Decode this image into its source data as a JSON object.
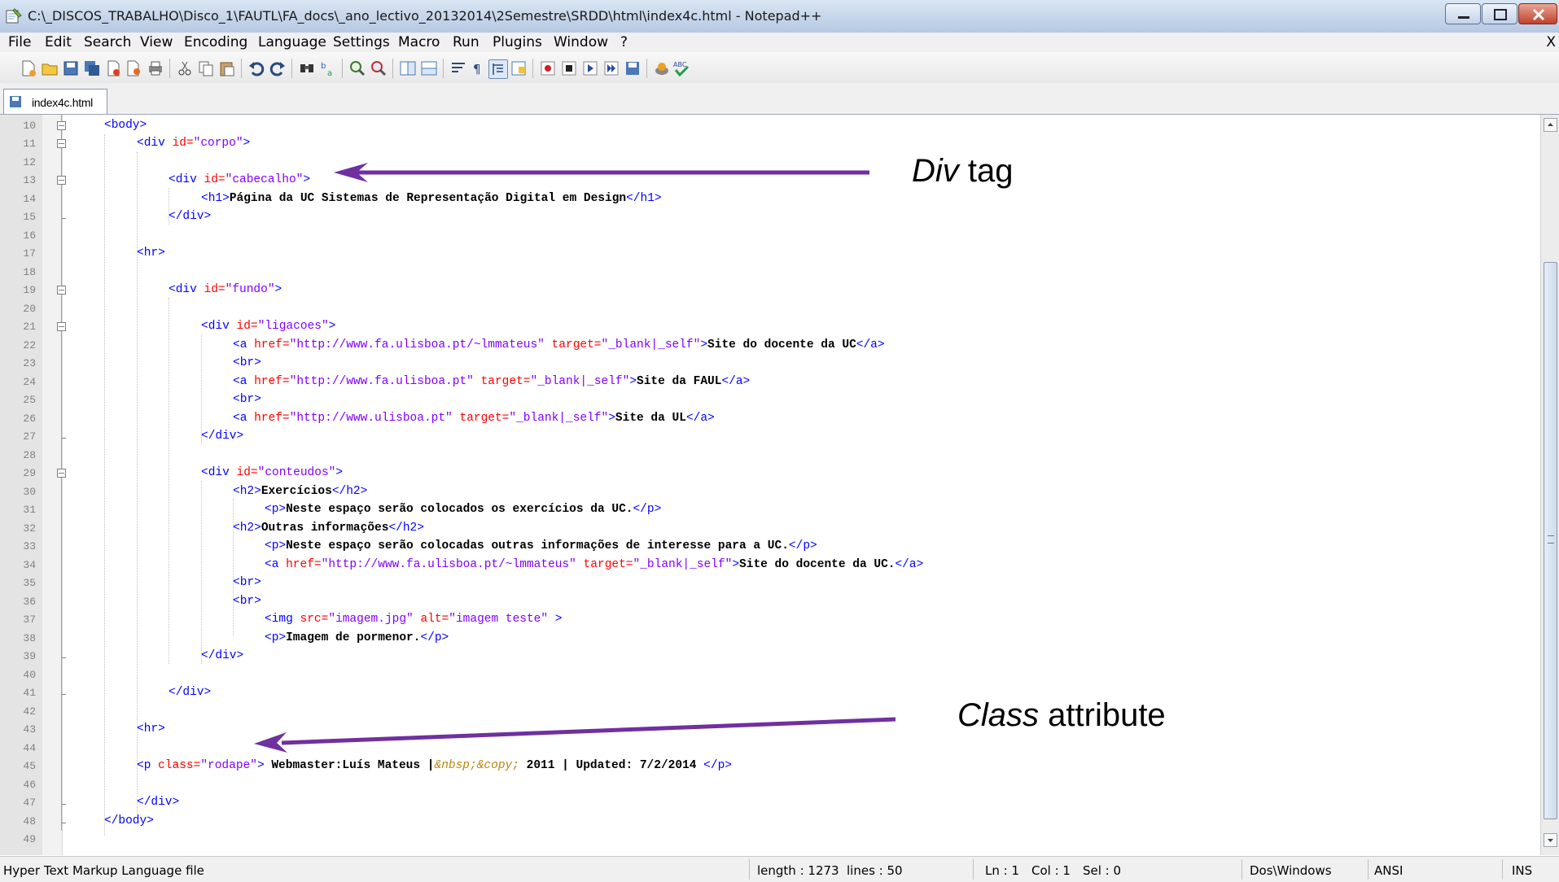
{
  "window": {
    "title": "C:\\_DISCOS_TRABALHO\\Disco_1\\FAUTL\\FA_docs\\_ano_lectivo_20132014\\2Semestre\\SRDD\\html\\index4c.html - Notepad++"
  },
  "menu": {
    "items": [
      "File",
      "Edit",
      "Search",
      "View",
      "Encoding",
      "Language",
      "Settings",
      "Macro",
      "Run",
      "Plugins",
      "Window",
      "?"
    ],
    "close_label": "X"
  },
  "tab": {
    "label": "index4c.html"
  },
  "editor": {
    "line_numbers": [
      "10",
      "11",
      "12",
      "13",
      "14",
      "15",
      "16",
      "17",
      "18",
      "19",
      "20",
      "21",
      "22",
      "23",
      "24",
      "25",
      "26",
      "27",
      "28",
      "29",
      "30",
      "31",
      "32",
      "33",
      "34",
      "35",
      "36",
      "37",
      "38",
      "39",
      "40",
      "41",
      "42",
      "43",
      "44",
      "45",
      "46",
      "47",
      "48",
      "49"
    ],
    "lines": {
      "l10_tag": "<body>",
      "l11_open": "<div ",
      "l11_attr": "id=",
      "l11_val": "\"corpo\"",
      "l11_close": ">",
      "l13_open": "<div ",
      "l13_attr": "id=",
      "l13_val": "\"cabecalho\"",
      "l13_close": ">",
      "l14_open": "<h1>",
      "l14_text": "Página da UC Sistemas de Representação Digital em Design",
      "l14_close": "</h1>",
      "l15_tag": "</div>",
      "l17_tag": "<hr>",
      "l19_open": "<div ",
      "l19_attr": "id=",
      "l19_val": "\"fundo\"",
      "l19_close": ">",
      "l21_open": "<div ",
      "l21_attr": "id=",
      "l21_val": "\"ligacoes\"",
      "l21_close": ">",
      "l22_open": "<a ",
      "l22_attr1": "href=",
      "l22_val1": "\"http://www.fa.ulisboa.pt/~lmmateus\"",
      "l22_attr2": " target=",
      "l22_val2": "\"_blank|_self\"",
      "l22_close": ">",
      "l22_text": "Site do docente da UC",
      "l22_end": "</a>",
      "l23_tag": "<br>",
      "l24_open": "<a ",
      "l24_attr1": "href=",
      "l24_val1": "\"http://www.fa.ulisboa.pt\"",
      "l24_attr2": " target=",
      "l24_val2": "\"_blank|_self\"",
      "l24_close": ">",
      "l24_text": "Site da FAUL",
      "l24_end": "</a>",
      "l25_tag": "<br>",
      "l26_open": "<a ",
      "l26_attr1": "href=",
      "l26_val1": "\"http://www.ulisboa.pt\"",
      "l26_attr2": " target=",
      "l26_val2": "\"_blank|_self\"",
      "l26_close": ">",
      "l26_text": "Site da UL",
      "l26_end": "</a>",
      "l27_tag": "</div>",
      "l29_open": "<div ",
      "l29_attr": "id=",
      "l29_val": "\"conteudos\"",
      "l29_close": ">",
      "l30_open": "<h2>",
      "l30_text": "Exercícios",
      "l30_close": "</h2>",
      "l31_open": "<p>",
      "l31_text": "Neste espaço serão colocados os exercícios da UC.",
      "l31_close": "</p>",
      "l32_open": "<h2>",
      "l32_text": "Outras informações",
      "l32_close": "</h2>",
      "l33_open": "<p>",
      "l33_text": "Neste espaço serão colocadas outras informações de interesse para a UC.",
      "l33_close": "</p>",
      "l34_open": "<a ",
      "l34_attr1": "href=",
      "l34_val1": "\"http://www.fa.ulisboa.pt/~lmmateus\"",
      "l34_attr2": " target=",
      "l34_val2": "\"_blank|_self\"",
      "l34_close": ">",
      "l34_text": "Site do docente da UC.",
      "l34_end": "</a>",
      "l35_tag": "<br>",
      "l36_tag": "<br>",
      "l37_open": "<img ",
      "l37_attr1": "src=",
      "l37_val1": "\"imagem.jpg\"",
      "l37_attr2": " alt=",
      "l37_val2": "\"imagem teste\"",
      "l37_close": " >",
      "l38_open": "<p>",
      "l38_text": "Imagem de pormenor.",
      "l38_close": "</p>",
      "l39_tag": "</div>",
      "l41_tag": "</div>",
      "l43_tag": "<hr>",
      "l45_open": "<p ",
      "l45_attr": "class=",
      "l45_val": "\"rodape\"",
      "l45_close": ">",
      "l45_text1": " Webmaster:Luís Mateus |",
      "l45_ent": "&nbsp;&copy;",
      "l45_text2": " 2011 | Updated: 7/2/2014 ",
      "l45_end": "</p>",
      "l47_tag": "</div>",
      "l48_tag": "</body>"
    }
  },
  "annotations": {
    "div_tag": {
      "italic": "Div",
      "rest": " tag"
    },
    "class_attr": {
      "italic": "Class",
      "rest": " attribute"
    },
    "arrow_color": "#7030a0"
  },
  "status": {
    "file_type": "Hyper Text Markup Language file",
    "length": "length : 1273",
    "lines": "lines : 50",
    "ln": "Ln : 1",
    "col": "Col : 1",
    "sel": "Sel : 0",
    "eol": "Dos\\Windows",
    "encoding": "ANSI",
    "mode": "INS"
  },
  "colors": {
    "tag": "#0000ff",
    "attribute": "#ff0000",
    "value": "#8000ff",
    "entity": "#b8860b"
  },
  "toolbar": {
    "icons": [
      "new-file-icon",
      "open-file-icon",
      "save-icon",
      "save-all-icon",
      "close-icon",
      "close-all-icon",
      "print-icon",
      "cut-icon",
      "copy-icon",
      "paste-icon",
      "undo-icon",
      "redo-icon",
      "find-icon",
      "replace-icon",
      "zoom-in-icon",
      "zoom-out-icon",
      "sync-v-icon",
      "sync-h-icon",
      "word-wrap-icon",
      "show-all-chars-icon",
      "indent-guide-icon",
      "doc-map-icon",
      "record-macro-icon",
      "stop-macro-icon",
      "play-macro-icon",
      "run-macro-multiple-icon",
      "save-macro-icon",
      "launch-browser-icon",
      "spellcheck-icon"
    ]
  }
}
